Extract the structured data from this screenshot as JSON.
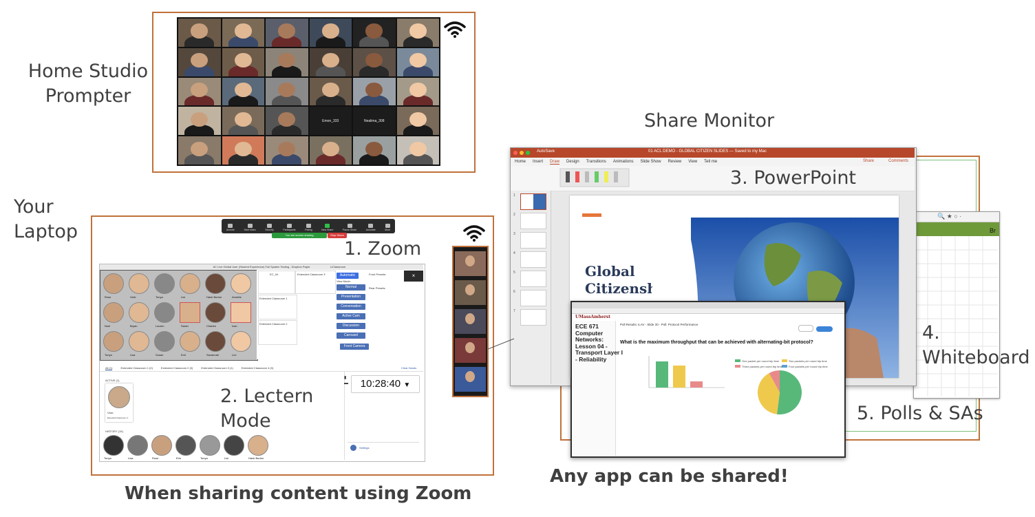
{
  "labels": {
    "home_studio": "Home Studio\nPrompter",
    "laptop": "Your\nLaptop",
    "share_monitor": "Share Monitor",
    "zoom": "1. Zoom",
    "lectern": "2. Lectern\nMode",
    "powerpoint": "3. PowerPoint",
    "whiteboard": "4.\nWhiteboard",
    "polls": "5. Polls & SAs",
    "caption_left": "When sharing content using Zoom",
    "caption_right": "Any app can be shared!"
  },
  "gallery_names": {
    "tile_a": "Emon_333",
    "tile_b": "Nealima_308"
  },
  "zoom_toolbar": {
    "items": [
      "Unmute",
      "Start Video",
      "Security",
      "Participants",
      "Polling",
      "New Share",
      "Pause Share",
      "Annotate",
      "More"
    ],
    "sharing_notice": "You are screen sharing",
    "stop": "Stop Share"
  },
  "lectern": {
    "title": "AC Live Global User (Student Experience) Full System Testing - Dropbox Paper",
    "classroom_title": "LiClassroom",
    "ec": "EC_04",
    "ext3": "Extended Classroom 3",
    "ext1": "Extended Classroom 1",
    "ext2": "Extended Classroom 2",
    "front_presets": "Front Presets:",
    "rear_presets": "Rear Presets:",
    "view_mode": "View Mode:",
    "modes": [
      "Automatic",
      "Normal",
      "Presentation",
      "Conversation",
      "Active Cam",
      "Discussion",
      "Carousel",
      "Front Camera"
    ],
    "tabs": [
      "All (1)",
      "Extended Classroom 1 (0)",
      "Extended Classroom 2 (0)",
      "Extended Classroom 3 (1)",
      "Extended Classroom 4 (0)"
    ],
    "clear_hands": "Clear Hands",
    "active": "ACTIVE (1)",
    "active_name": "Vicki",
    "active_sub": "Extended Classroom 1",
    "history": "HISTORY (19)",
    "clock": "10:28:40",
    "settings": "Settings",
    "people_row1": [
      "Rose",
      "Vicki",
      "Tonya",
      "Lisi",
      "Hank Burton",
      "Annette"
    ],
    "people_row2": [
      "Noel",
      "Bryan",
      "Lauren",
      "Sarah",
      "Charles",
      "Ivan"
    ],
    "people_row3": [
      "Tonya",
      "Lisa",
      "Susan",
      "Enil",
      "Savannah",
      "Lex"
    ],
    "history_names": [
      "Tonya",
      "Lisa",
      "Rose",
      "Erin",
      "Tonya",
      "Lisi",
      "Hank Burton"
    ]
  },
  "ppt": {
    "window_title": "01 ACL DEMO - GLOBAL CITIZEN SLIDES — Saved to my Mac",
    "autosave": "AutoSave",
    "menu": [
      "Home",
      "Insert",
      "Draw",
      "Design",
      "Transitions",
      "Animations",
      "Slide Show",
      "Review",
      "View",
      "Tell me"
    ],
    "share": "Share",
    "comments": "Comments",
    "slide_title": "Global\nCitizenship",
    "thumbs": [
      "1",
      "2",
      "3",
      "4",
      "5",
      "6",
      "7"
    ]
  },
  "polls": {
    "course": "ECE 671\nComputer\nNetworks:\nLesson 04 -\nTransport Layer I\n- Reliability",
    "brand": "UMassAmherst",
    "header": "Poll Results: iLAV - Slide 30 - Poll: Protocol Performance",
    "question": "What is the maximum throughput that can be achieved with alternating-bit protocol?",
    "legend": [
      "One packet per round trip time",
      "Two packets per round trip time",
      "Three packets per round trip time",
      "Four packets per round trip time"
    ]
  },
  "colors": {
    "accent": "#c0713a",
    "pie_green": "#58b87a",
    "pie_yellow": "#efc94c",
    "pie_pink": "#e88a8a",
    "zoom_blue": "#4a6fb5"
  }
}
